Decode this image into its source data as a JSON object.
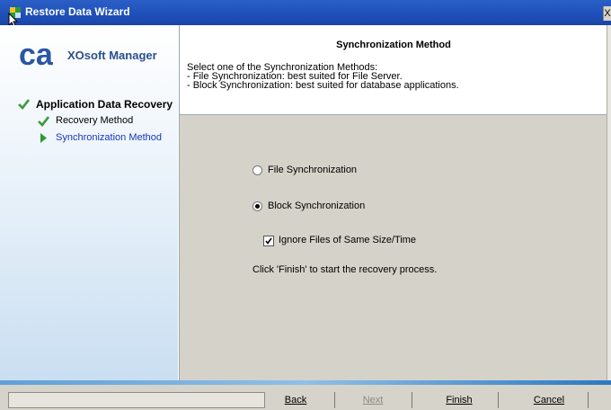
{
  "window": {
    "title": "Restore Data Wizard",
    "close_glyph": "X"
  },
  "sidebar": {
    "brand": "XOsoft Manager",
    "logo_text": "ca",
    "steps": [
      {
        "label": "Application Data Recovery",
        "state": "done",
        "icon": "check-icon"
      },
      {
        "label": "Recovery Method",
        "state": "done",
        "icon": "check-icon"
      },
      {
        "label": "Synchronization Method",
        "state": "current",
        "icon": "arrow-right-icon"
      }
    ]
  },
  "header": {
    "title": "Synchronization Method",
    "lines": [
      "Select one of the Synchronization Methods:",
      "- File Synchronization: best suited for File Server.",
      "- Block Synchronization: best suited for database applications."
    ]
  },
  "options": {
    "file_sync": {
      "label": "File Synchronization",
      "selected": false
    },
    "block_sync": {
      "label": "Block Synchronization",
      "selected": true
    },
    "ignore_same": {
      "label": "Ignore Files of Same Size/Time",
      "checked": true
    },
    "hint": "Click 'Finish' to start the recovery process."
  },
  "footer": {
    "back": "Back",
    "next": "Next",
    "finish": "Finish",
    "cancel": "Cancel"
  },
  "colors": {
    "titlebar": "#1f4fb8",
    "current_step": "#1a35b8",
    "panel": "#d5d2ca",
    "check": "#3a9a3a"
  }
}
